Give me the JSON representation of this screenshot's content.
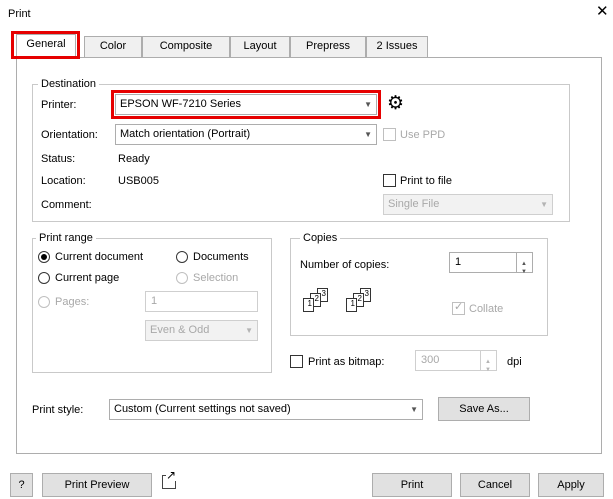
{
  "window": {
    "title": "Print",
    "close_glyph": "✕"
  },
  "tabs": [
    {
      "label": "General"
    },
    {
      "label": "Color"
    },
    {
      "label": "Composite"
    },
    {
      "label": "Layout"
    },
    {
      "label": "Prepress"
    },
    {
      "label": "2 Issues"
    }
  ],
  "highlight_color": "#e60000",
  "destination": {
    "legend": "Destination",
    "printer_label": "Printer:",
    "printer_value": "EPSON WF-7210 Series",
    "settings_icon": "gear-icon",
    "orientation_label": "Orientation:",
    "orientation_value": "Match orientation (Portrait)",
    "use_ppd_label": "Use PPD",
    "status_label": "Status:",
    "status_value": "Ready",
    "location_label": "Location:",
    "location_value": "USB005",
    "print_to_file_label": "Print to file",
    "comment_label": "Comment:",
    "file_mode_value": "Single File"
  },
  "print_range": {
    "legend": "Print range",
    "current_document": "Current document",
    "documents": "Documents",
    "current_page": "Current page",
    "selection": "Selection",
    "pages_label": "Pages:",
    "pages_value": "1",
    "page_filter_value": "Even & Odd"
  },
  "copies": {
    "legend": "Copies",
    "number_label": "Number of copies:",
    "number_value": "1",
    "collate_label": "Collate",
    "collate_checked": true
  },
  "bitmap": {
    "label": "Print as bitmap:",
    "dpi_value": "300",
    "dpi_unit": "dpi"
  },
  "print_style": {
    "label": "Print style:",
    "value": "Custom (Current settings not saved)",
    "save_as_label": "Save As..."
  },
  "footer": {
    "help_label": "?",
    "preview_label": "Print Preview",
    "print_label": "Print",
    "cancel_label": "Cancel",
    "apply_label": "Apply"
  }
}
